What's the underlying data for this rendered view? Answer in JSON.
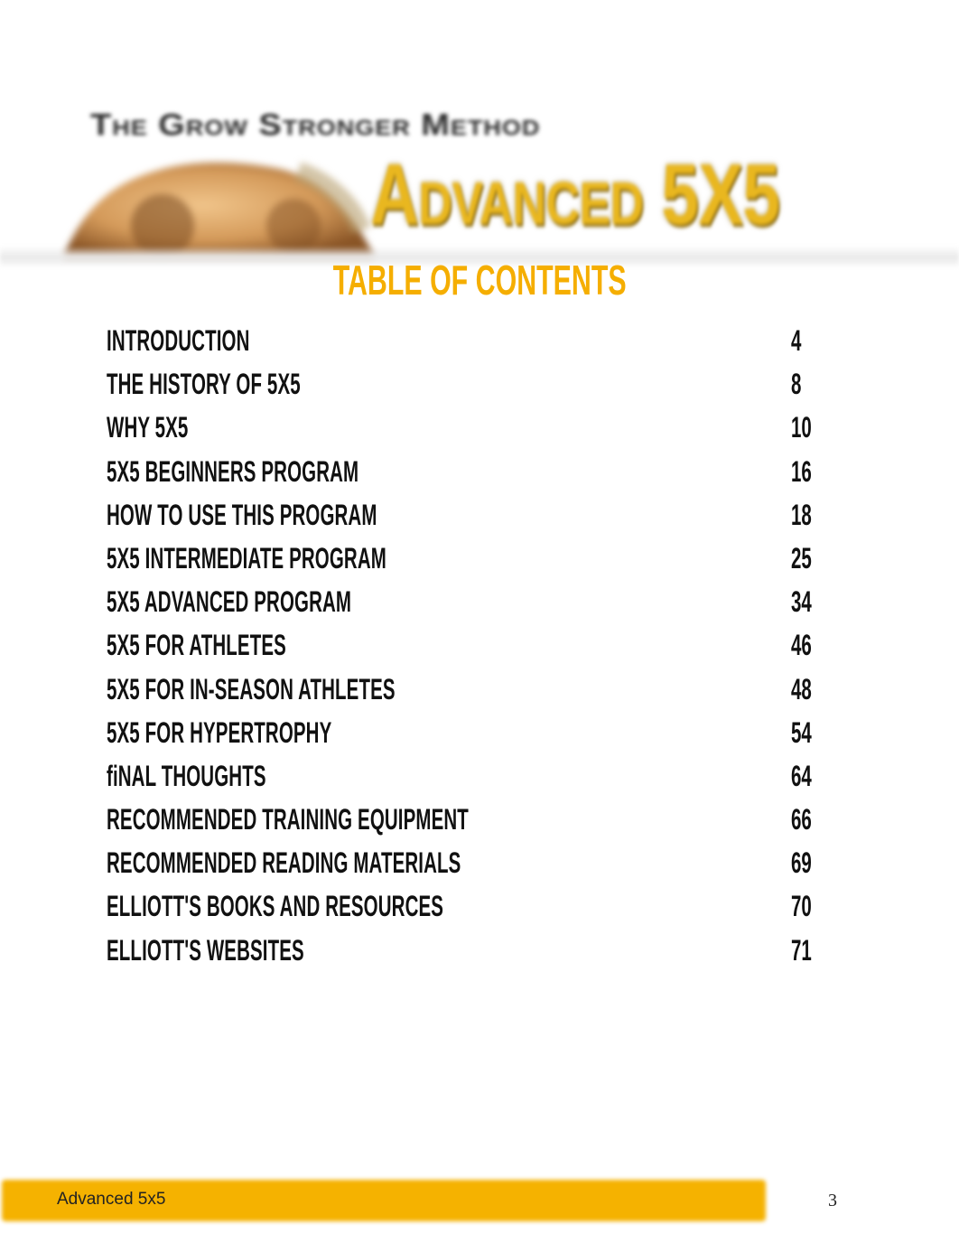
{
  "banner": {
    "subtitle": "The Grow Stronger Method",
    "title": "Advanced 5X5",
    "colors": {
      "title": "#e9b71f",
      "subtitle": "#2b2b2b"
    }
  },
  "toc": {
    "title": "TABLE OF CONTENTS",
    "title_color": "#f5ae00",
    "entries": [
      {
        "label": "INTRODUCTION",
        "page": "4"
      },
      {
        "label": "THE HISTORY OF 5X5",
        "page": "8"
      },
      {
        "label": "WHY 5X5",
        "page": "10"
      },
      {
        "label": "5X5 BEGINNERS PROGRAM",
        "page": "16"
      },
      {
        "label": "HOW TO USE THIS PROGRAM",
        "page": "18"
      },
      {
        "label": "5X5 INTERMEDIATE PROGRAM",
        "page": "25"
      },
      {
        "label": "5X5 ADVANCED PROGRAM",
        "page": "34"
      },
      {
        "label": "5X5 FOR ATHLETES",
        "page": "46"
      },
      {
        "label": "5X5 FOR IN-SEASON ATHLETES",
        "page": "48"
      },
      {
        "label": "5X5 FOR HYPERTROPHY",
        "page": "54"
      },
      {
        "label": "fiNAL THOUGHTS",
        "page": "64"
      },
      {
        "label": "RECOMMENDED TRAINING EQUIPMENT",
        "page": "66"
      },
      {
        "label": "RECOMMENDED READING MATERIALS",
        "page": "69"
      },
      {
        "label": "ELLIOTT'S BOOKS AND RESOURCES",
        "page": "70"
      },
      {
        "label": "ELLIOTT'S WEBSITES",
        "page": "71"
      }
    ]
  },
  "footer": {
    "label": "Advanced 5x5",
    "page_number": "3",
    "bar_color": "#f5b200"
  }
}
